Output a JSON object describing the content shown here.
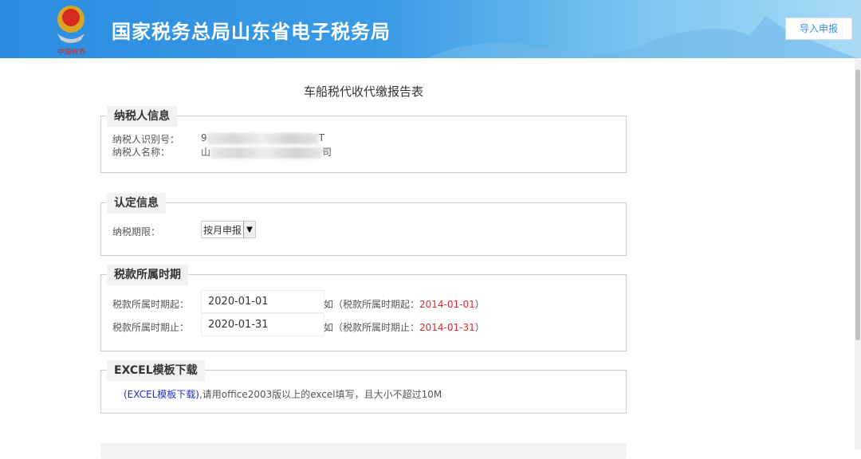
{
  "header": {
    "site_title": "国家税务总局山东省电子税务局",
    "emblem_text": "中国税务",
    "import_button": "导入申报"
  },
  "page_title": "车船税代收代缴报告表",
  "taxpayer": {
    "legend": "纳税人信息",
    "id_label": "纳税人识别号：",
    "id_prefix": "9",
    "id_suffix": "T",
    "name_label": "纳税人名称：",
    "name_prefix": "山",
    "name_suffix": "司"
  },
  "determination": {
    "legend": "认定信息",
    "period_label": "纳税期限：",
    "period_value": "按月申报"
  },
  "tax_period": {
    "legend": "税款所属时期",
    "start_label": "税款所属时期起：",
    "start_value": "2020-01-01",
    "start_hint_prefix": "如（税款所属时期起：",
    "start_hint_example": "2014-01-01",
    "hint_suffix": "）",
    "end_label": "税款所属时期止：",
    "end_value": "2020-01-31",
    "end_hint_prefix": "如（税款所属时期止：",
    "end_hint_example": "2014-01-31"
  },
  "excel": {
    "legend": "EXCEL模板下载",
    "link": "(EXCEL模板下载)",
    "note": ",请用office2003版以上的excel填写，且大小不超过10M"
  }
}
